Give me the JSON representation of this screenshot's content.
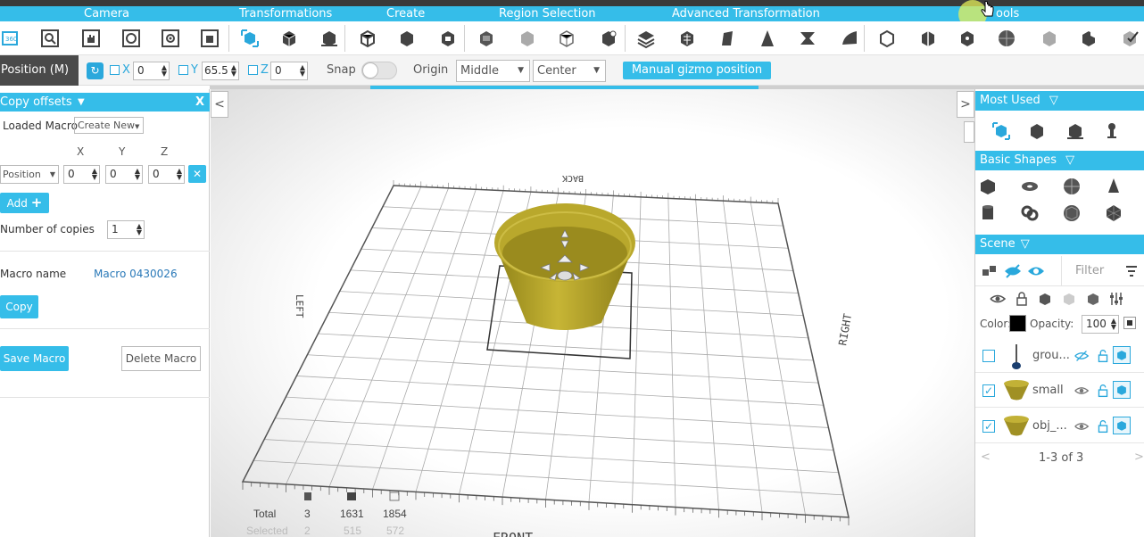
{
  "menu": {
    "camera": "Camera",
    "transformations": "Transformations",
    "create": "Create",
    "region_selection": "Region Selection",
    "advanced_transformation": "Advanced Transformation",
    "tools": "ools"
  },
  "position_bar": {
    "title": "Position (M)",
    "x_label": "X",
    "x_value": "0",
    "y_label": "Y",
    "y_value": "65.5",
    "z_label": "Z",
    "z_value": "0",
    "snap_label": "Snap",
    "origin_label": "Origin",
    "origin_vertical": "Middle",
    "origin_horizontal": "Center",
    "manual_gizmo": "Manual gizmo position"
  },
  "left_panel": {
    "title": "Copy offsets",
    "close": "X",
    "loaded_macro_label": "Loaded Macro",
    "loaded_macro_value": "Create New",
    "col_x": "X",
    "col_y": "Y",
    "col_z": "Z",
    "offset_type": "Position",
    "offset_x": "0",
    "offset_y": "0",
    "offset_z": "0",
    "add_label": "Add",
    "copies_label": "Number of copies",
    "copies_value": "1",
    "macro_name_label": "Macro name",
    "macro_name_value": "Macro 0430026",
    "copy_label": "Copy",
    "save_macro": "Save Macro",
    "delete_macro": "Delete Macro"
  },
  "viewport": {
    "label_back": "BACK",
    "label_left": "LEFT",
    "label_right": "RIGHT",
    "label_front": "FRONT",
    "stats": {
      "total_label": "Total",
      "selected_label": "Selected",
      "total": [
        "3",
        "1631",
        "1854"
      ],
      "selected": [
        "2",
        "515",
        "572"
      ]
    }
  },
  "right_panel": {
    "most_used": "Most Used",
    "basic_shapes": "Basic Shapes",
    "scene": "Scene",
    "filter_placeholder": "Filter",
    "color_label": "Color:",
    "opacity_label": "Opacity:",
    "opacity_value": "100",
    "color_value": "#000000",
    "objects": [
      {
        "name": "grou...",
        "checked": false
      },
      {
        "name": "small",
        "checked": true
      },
      {
        "name": "obj_...",
        "checked": true
      }
    ],
    "pagination": "1-3 of 3"
  },
  "colors": {
    "accent": "#35bde9",
    "model": "#b3a22a",
    "model_dark": "#8a7c18"
  }
}
